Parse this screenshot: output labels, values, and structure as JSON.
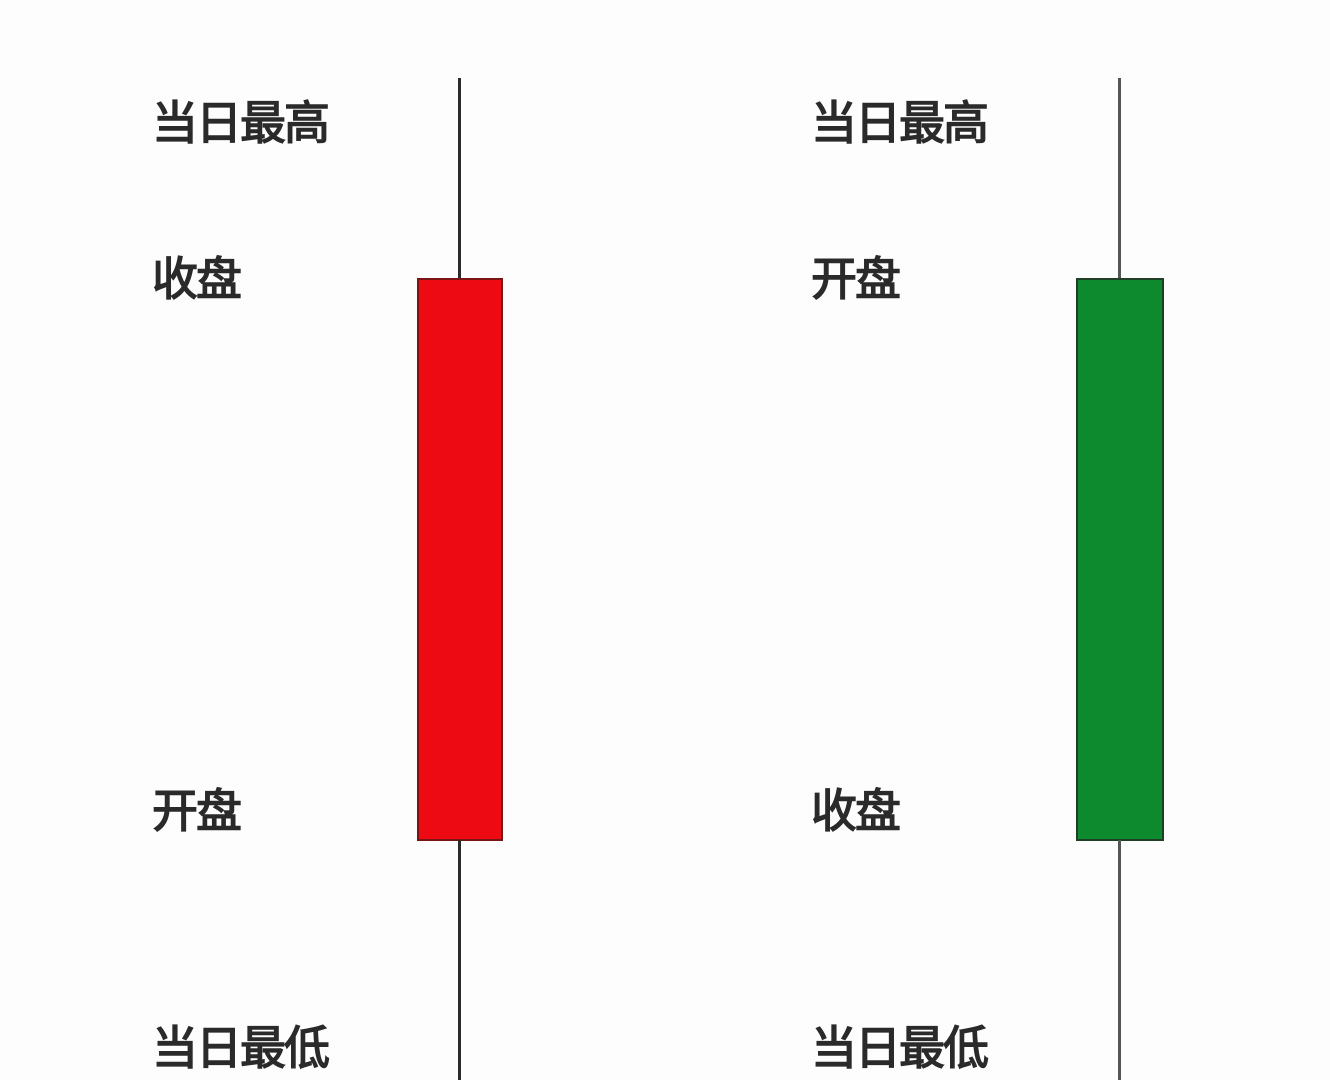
{
  "candles": [
    {
      "color": "#ee0a12",
      "labels": {
        "high": "当日最高",
        "body_top": "收盘",
        "body_bottom": "开盘",
        "low": "当日最低"
      }
    },
    {
      "color": "#0e8a2e",
      "labels": {
        "high": "当日最高",
        "body_top": "开盘",
        "body_bottom": "收盘",
        "low": "当日最低"
      }
    }
  ]
}
